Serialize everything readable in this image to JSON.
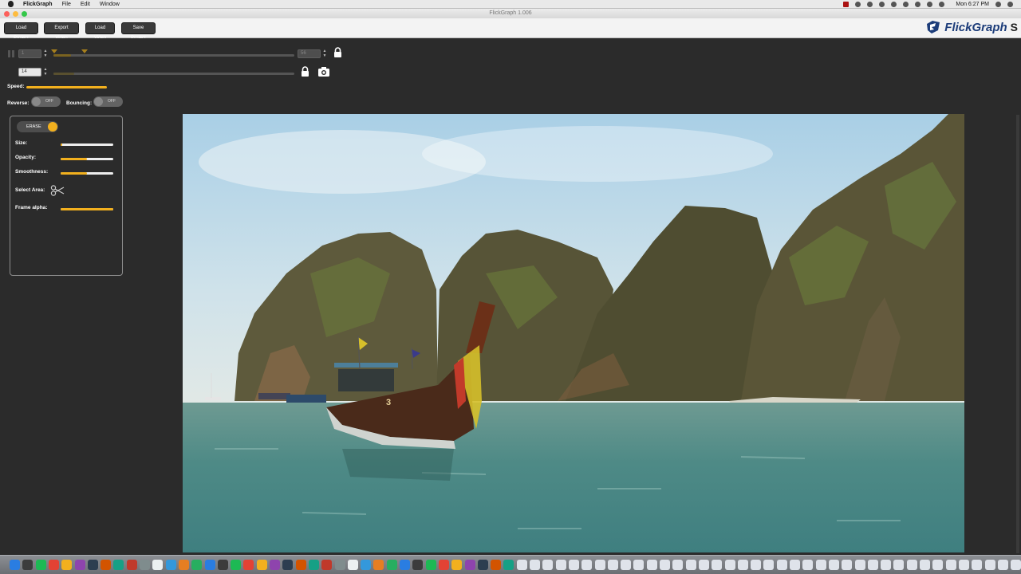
{
  "menubar": {
    "app_name": "FlickGraph",
    "items": [
      "File",
      "Edit",
      "Window"
    ],
    "clock": "Mon 6:27 PM"
  },
  "window": {
    "title": "FlickGraph 1.006"
  },
  "toolbar": {
    "load_project": "Load Project",
    "export_video": "Export Video",
    "load_video": "Load Video",
    "save_project": "Save Project"
  },
  "logo": {
    "text": "FlickGraph"
  },
  "timeline": {
    "start_frame": "1",
    "end_frame": "56",
    "frame_value": "14"
  },
  "controls": {
    "speed_label": "Speed:",
    "reverse_label": "Reverse:",
    "reverse_state": "OFF",
    "bouncing_label": "Bouncing:",
    "bouncing_state": "OFF"
  },
  "erase_panel": {
    "toggle_label": "ERASE",
    "size_label": "Size:",
    "opacity_label": "Opacity:",
    "smoothness_label": "Smoothness:",
    "select_area_label": "Select Area:",
    "frame_alpha_label": "Frame alpha:",
    "size_value": 0.03,
    "opacity_value": 0.5,
    "smoothness_value": 0.5,
    "frame_alpha_value": 1.0
  },
  "colors": {
    "accent": "#f2b01e",
    "background": "#2b2b2b",
    "brand": "#1d3d7a"
  },
  "dock": {
    "icon_count": 95
  }
}
